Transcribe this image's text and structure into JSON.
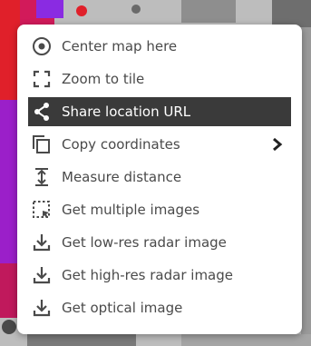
{
  "context_menu": {
    "items": [
      {
        "label": "Center map here",
        "icon": "crosshair-icon"
      },
      {
        "label": "Zoom to tile",
        "icon": "zoom-frame-icon"
      },
      {
        "label": "Share location URL",
        "icon": "share-icon",
        "active": true
      },
      {
        "label": "Copy coordinates",
        "icon": "copy-icon",
        "has_submenu": true
      },
      {
        "label": "Measure distance",
        "icon": "measure-icon"
      },
      {
        "label": "Get multiple images",
        "icon": "select-area-icon"
      },
      {
        "label": "Get low-res radar image",
        "icon": "download-icon"
      },
      {
        "label": "Get high-res radar image",
        "icon": "download-icon"
      },
      {
        "label": "Get optical image",
        "icon": "download-icon"
      }
    ],
    "colors": {
      "text": "#4a4a4a",
      "active_bg": "#3a3a3a",
      "active_text": "#ffffff",
      "panel": "#ffffff"
    }
  }
}
